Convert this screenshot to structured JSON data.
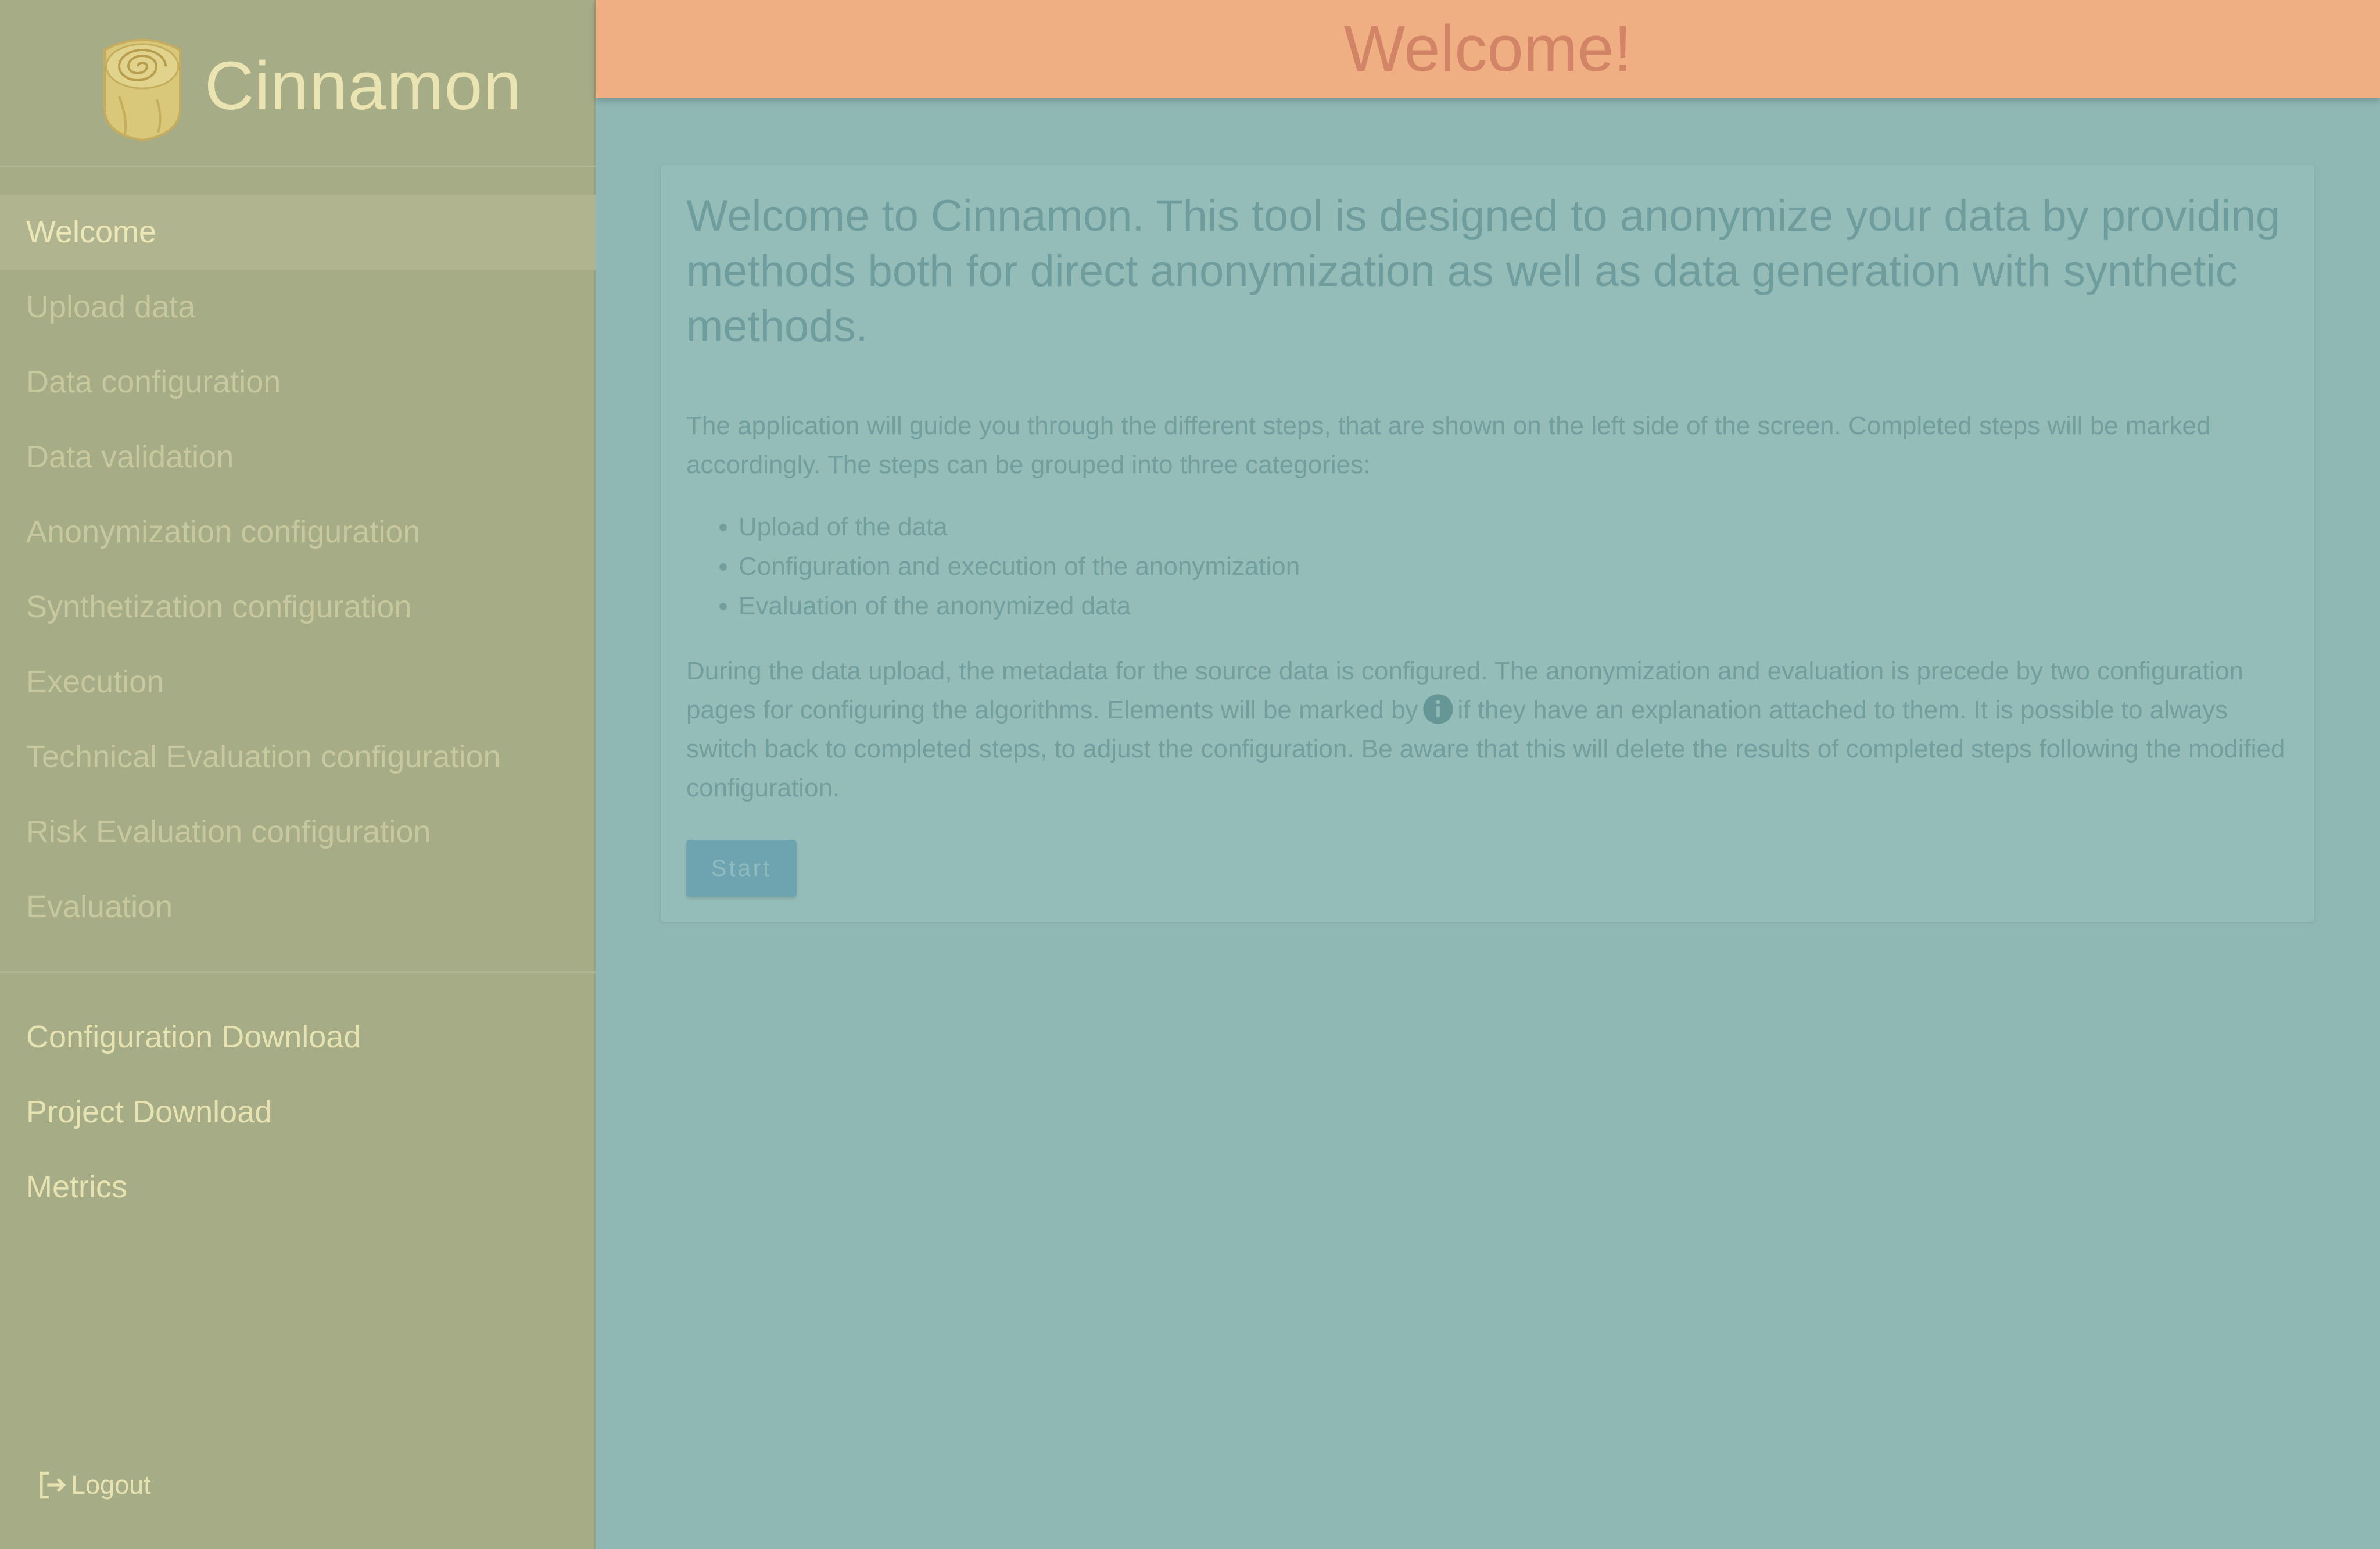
{
  "app": {
    "name": "Cinnamon"
  },
  "header": {
    "title": "Welcome!"
  },
  "sidebar": {
    "steps": [
      {
        "label": "Welcome",
        "active": true
      },
      {
        "label": "Upload data",
        "active": false
      },
      {
        "label": "Data configuration",
        "active": false
      },
      {
        "label": "Data validation",
        "active": false
      },
      {
        "label": "Anonymization configuration",
        "active": false
      },
      {
        "label": "Synthetization configuration",
        "active": false
      },
      {
        "label": "Execution",
        "active": false
      },
      {
        "label": "Technical Evaluation configuration",
        "active": false
      },
      {
        "label": "Risk Evaluation configuration",
        "active": false
      },
      {
        "label": "Evaluation",
        "active": false
      }
    ],
    "tools": [
      {
        "label": "Configuration Download"
      },
      {
        "label": "Project Download"
      },
      {
        "label": "Metrics"
      }
    ],
    "logout_label": "Logout"
  },
  "main": {
    "intro": "Welcome to Cinnamon. This tool is designed to anonymize your data by providing methods both for direct anonymization as well as data generation with synthetic methods.",
    "paragraph1": "The application will guide you through the different steps, that are shown on the left side of the screen. Completed steps will be marked accordingly. The steps can be grouped into three categories:",
    "categories": [
      "Upload of the data",
      "Configuration and execution of the anonymization",
      "Evaluation of the anonymized data"
    ],
    "paragraph2_before_icon": "During the data upload, the metadata for the source data is configured. The anonymization and evaluation is precede by two configuration pages for configuring the algorithms. Elements will be marked by",
    "paragraph2_after_icon": "if they have an explanation attached to them. It is possible to always switch back to completed steps, to adjust the configuration. Be aware that this will delete the results of completed steps following the modified configuration.",
    "start_label": "Start"
  },
  "colors": {
    "sidebar_bg": "#a5ac86",
    "header_bg": "#f0ae83",
    "content_bg": "#8fb7b4",
    "accent_button": "#6ea4b0"
  },
  "icons": {
    "logo": "cinnamon-roll-logo",
    "info": "info-icon",
    "logout": "logout-icon"
  }
}
